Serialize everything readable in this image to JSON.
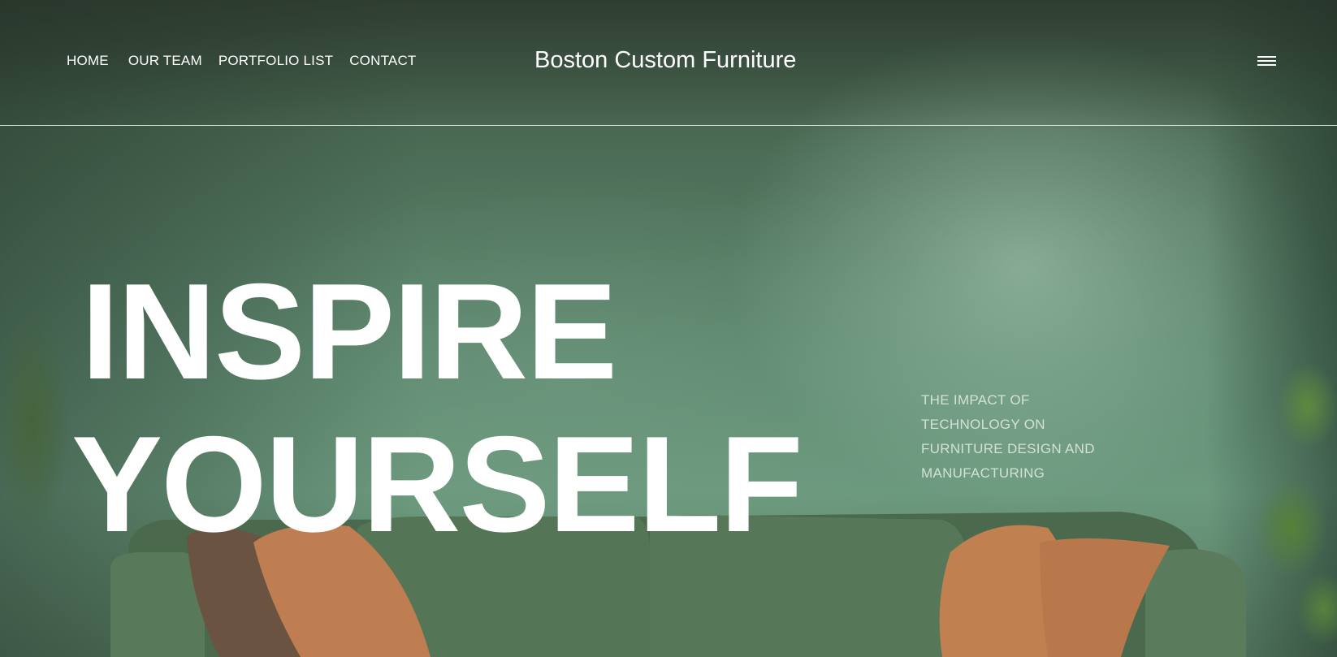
{
  "header": {
    "nav": [
      "HOME",
      "OUR TEAM",
      "PORTFOLIO LIST",
      "CONTACT"
    ],
    "brand": "Boston Custom Furniture",
    "menu_icon": "hamburger-menu-icon"
  },
  "hero": {
    "headline_line1": "INSPIRE",
    "headline_line2": "YOURSELF",
    "tagline": "THE IMPACT OF TECHNOLOGY ON FURNITURE DESIGN AND MANUFACTURING"
  },
  "colors": {
    "wall_green": "#5f8a71",
    "sofa_green": "#4f6e50",
    "pillow_orange": "#c07e52",
    "text_white": "#ffffff"
  }
}
